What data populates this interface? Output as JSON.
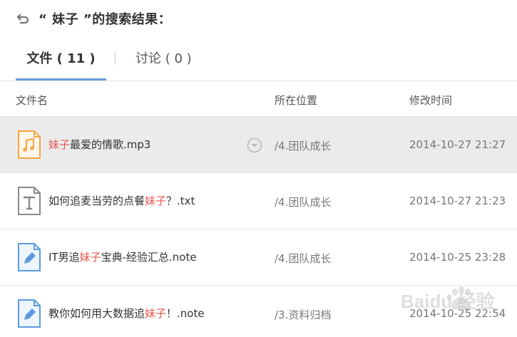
{
  "header": {
    "title": "“ 妹子 ”的搜索结果："
  },
  "tabs": [
    {
      "label": "文件 ( 11 )",
      "active": true
    },
    {
      "label": "讨论 ( 0 )",
      "active": false
    }
  ],
  "columns": {
    "name": "文件名",
    "location": "所在位置",
    "modified": "修改时间"
  },
  "files": [
    {
      "name_pre": "",
      "name_hl": "妹子",
      "name_post": "最爱的情歌.mp3",
      "location": "/4.团队成长",
      "time": "2014-10-27 21:27",
      "icon": "audio-file-icon"
    },
    {
      "name_pre": "如何追麦当劳的点餐",
      "name_hl": "妹子",
      "name_post": "？.txt",
      "location": "/4.团队成长",
      "time": "2014-10-27 21:23",
      "icon": "text-file-icon"
    },
    {
      "name_pre": "IT男追",
      "name_hl": "妹子",
      "name_post": "宝典-经验汇总.note",
      "location": "/4.团队成长",
      "time": "2014-10-25 23:28",
      "icon": "note-file-icon"
    },
    {
      "name_pre": "教你如何用大数据追",
      "name_hl": "妹子",
      "name_post": "！.note",
      "location": "/3.资料归档",
      "time": "2014-10-25 22:54",
      "icon": "note-file-icon"
    }
  ],
  "watermark": {
    "text": "Baidu 经验"
  },
  "colors": {
    "highlight": "#e8574f",
    "tab_underline": "#6d9de0",
    "audio_icon": "#f5a640",
    "note_icon": "#5b9be0",
    "selected_row": "#ebebeb"
  }
}
